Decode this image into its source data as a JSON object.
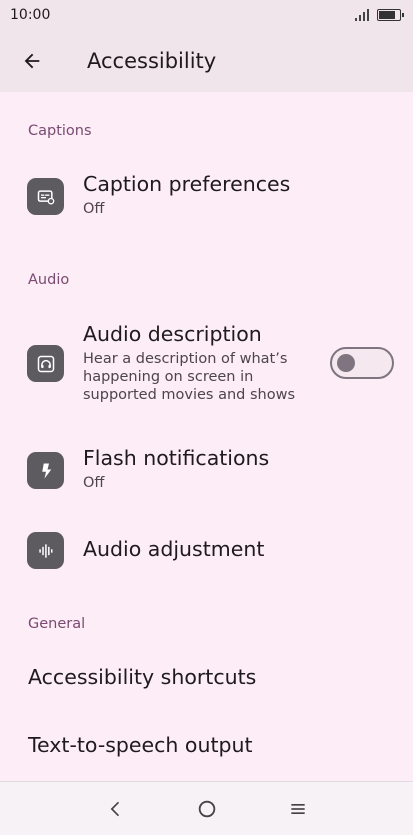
{
  "status": {
    "time": "10:00"
  },
  "app_bar": {
    "title": "Accessibility"
  },
  "sections": {
    "captions": {
      "header": "Captions",
      "caption_preferences": {
        "title": "Caption preferences",
        "subtitle": "Off"
      }
    },
    "audio": {
      "header": "Audio",
      "audio_description": {
        "title": "Audio description",
        "subtitle_line1": "Hear a description of what’s",
        "subtitle_line2": "happening on screen in",
        "subtitle_line3": "supported movies and shows",
        "enabled": false
      },
      "flash_notifications": {
        "title": "Flash notifications",
        "subtitle": "Off"
      },
      "audio_adjustment": {
        "title": "Audio adjustment"
      }
    },
    "general": {
      "header": "General",
      "accessibility_shortcuts": {
        "title": "Accessibility shortcuts"
      },
      "tts_output": {
        "title": "Text-to-speech output"
      }
    }
  },
  "icons": {
    "back": "arrow-left-icon",
    "captions": "closed-caption-settings-icon",
    "audio_description": "headphones-icon",
    "flash": "flash-icon",
    "audio_adjustment": "waveform-icon",
    "nav_back": "chevron-left-icon",
    "nav_home": "circle-icon",
    "nav_recents": "menu-lines-icon"
  },
  "colors": {
    "background": "#fcedf6",
    "app_bar": "#f1e5ec",
    "section_header": "#7a4a72",
    "icon_bg": "#5d5a60"
  }
}
